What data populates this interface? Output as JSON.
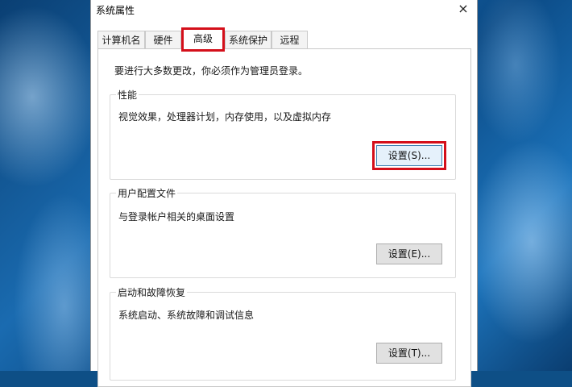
{
  "window": {
    "title": "系统属性",
    "close_glyph": "×"
  },
  "tabs": [
    {
      "label": "计算机名"
    },
    {
      "label": "硬件"
    },
    {
      "label": "高级",
      "active": true
    },
    {
      "label": "系统保护"
    },
    {
      "label": "远程"
    }
  ],
  "panel": {
    "notice": "要进行大多数更改，你必须作为管理员登录。",
    "groups": [
      {
        "legend": "性能",
        "description": "视觉效果，处理器计划，内存使用，以及虚拟内存",
        "button": "设置(S)..."
      },
      {
        "legend": "用户配置文件",
        "description": "与登录帐户相关的桌面设置",
        "button": "设置(E)..."
      },
      {
        "legend": "启动和故障恢复",
        "description": "系统启动、系统故障和调试信息",
        "button": "设置(T)..."
      }
    ]
  },
  "colors": {
    "highlight": "#d40f1a",
    "desktop": "#0e4f86"
  }
}
